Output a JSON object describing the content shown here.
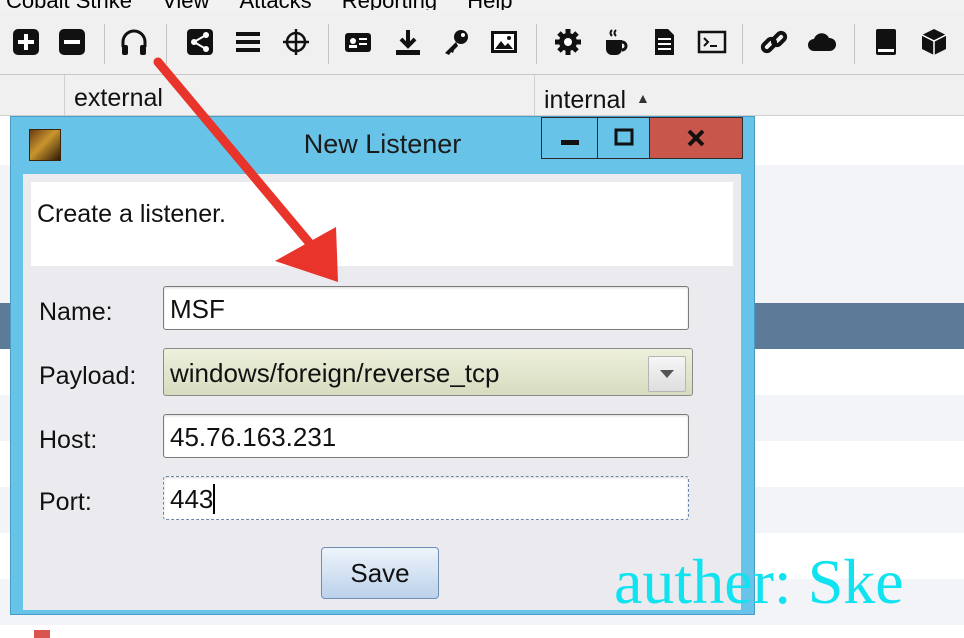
{
  "menubar": {
    "items": [
      "Cobalt Strike",
      "View",
      "Attacks",
      "Reporting",
      "Help"
    ]
  },
  "toolbar": {
    "buttons": [
      {
        "icon": "plus-square-icon"
      },
      {
        "icon": "minus-square-icon"
      },
      {
        "icon": "headphones-icon"
      },
      {
        "icon": "share-graph-icon"
      },
      {
        "icon": "list-icon"
      },
      {
        "icon": "crosshair-icon"
      },
      {
        "icon": "id-card-icon"
      },
      {
        "icon": "download-icon"
      },
      {
        "icon": "key-icon"
      },
      {
        "icon": "image-icon"
      },
      {
        "icon": "gear-icon"
      },
      {
        "icon": "coffee-cup-icon"
      },
      {
        "icon": "document-icon"
      },
      {
        "icon": "terminal-icon"
      },
      {
        "icon": "link-icon"
      },
      {
        "icon": "cloud-icon"
      },
      {
        "icon": "book-icon"
      },
      {
        "icon": "cube-icon"
      }
    ]
  },
  "table": {
    "columns": [
      "",
      "external",
      "internal"
    ],
    "sort_indicator": "▲"
  },
  "dialog": {
    "title": "New Listener",
    "minimize_label": "▁",
    "maximize_label": "□",
    "close_label": "X",
    "description": "Create a listener.",
    "fields": {
      "name_label": "Name:",
      "name_value": "MSF",
      "payload_label": "Payload:",
      "payload_value": "windows/foreign/reverse_tcp",
      "host_label": "Host:",
      "host_value": "45.76.163.231",
      "port_label": "Port:",
      "port_value": "443"
    },
    "save_label": "Save"
  },
  "watermark": "auther: Ske",
  "colors": {
    "dialog_frame": "#67c3e8",
    "close_button": "#c8564b",
    "selected_row": "#5d7a99",
    "annotation_arrow": "#e8342a",
    "watermark": "#10e2f0"
  }
}
